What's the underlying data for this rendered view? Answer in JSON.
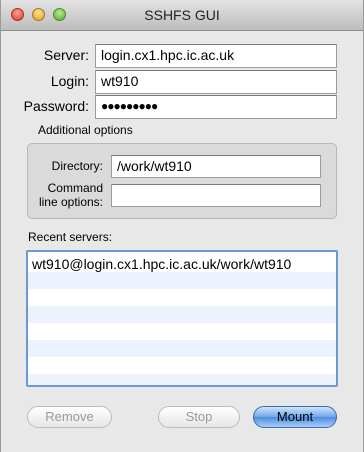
{
  "window": {
    "title": "SSHFS GUI"
  },
  "form": {
    "server_label": "Server:",
    "server_value": "login.cx1.hpc.ic.ac.uk",
    "login_label": "Login:",
    "login_value": "wt910",
    "password_label": "Password:",
    "password_value": "●●●●●●●●●"
  },
  "additional": {
    "heading": "Additional options",
    "directory_label": "Directory:",
    "directory_value": "/work/wt910",
    "command_label_line1": "Command",
    "command_label_line2": "line options:",
    "command_value": ""
  },
  "recent": {
    "heading": "Recent servers:",
    "items": [
      "wt910@login.cx1.hpc.ic.ac.uk/work/wt910"
    ]
  },
  "buttons": {
    "remove": "Remove",
    "stop": "Stop",
    "mount": "Mount"
  }
}
